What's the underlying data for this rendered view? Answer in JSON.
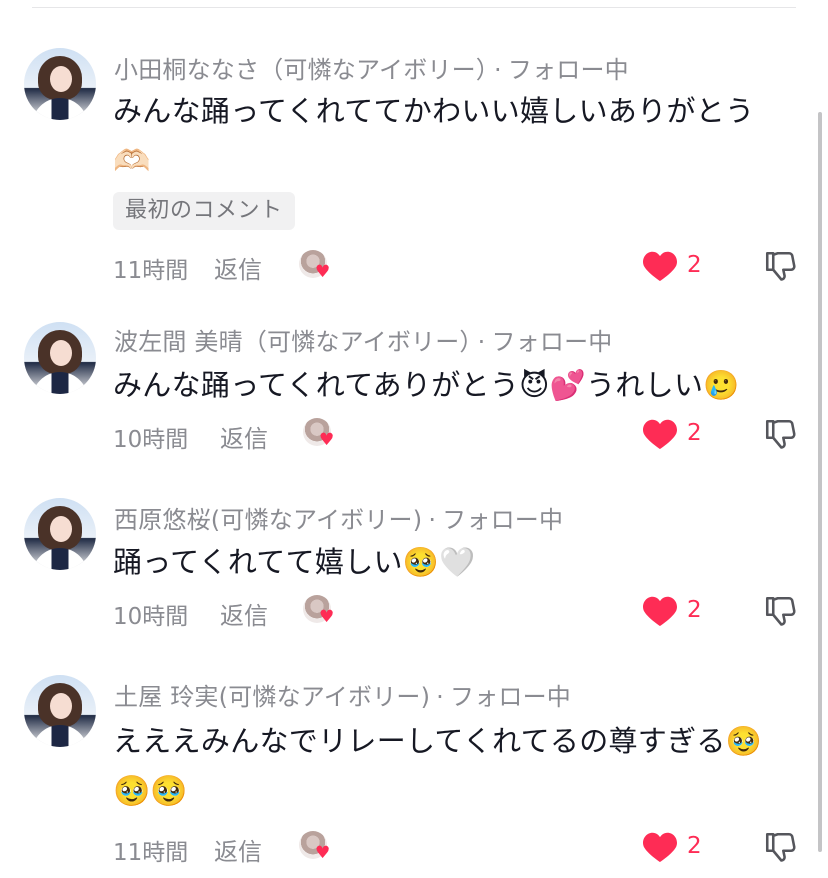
{
  "comments": [
    {
      "name": "小田桐ななさ（可憐なアイボリー）",
      "follow": "フォロー中",
      "text": "みんな踊ってくれててかわいい嬉しいありがとう",
      "emoji_line": "🫶🏻",
      "tag": "最初のコメント",
      "time": "11時間",
      "reply": "返信",
      "likes": "2"
    },
    {
      "name": "波左間 美晴（可憐なアイボリー）",
      "follow": "フォロー中",
      "text": "みんな踊ってくれてありがとう😈💕うれしい🥲",
      "time": "10時間",
      "reply": "返信",
      "likes": "2"
    },
    {
      "name": "西原悠桜(可憐なアイボリー)",
      "follow": "フォロー中",
      "text": "踊ってくれてて嬉しい🥹🤍",
      "time": "10時間",
      "reply": "返信",
      "likes": "2"
    },
    {
      "name": "土屋 玲実(可憐なアイボリー)",
      "follow": "フォロー中",
      "text": "えええみんなでリレーしてくれてるの尊すぎる🥹",
      "emoji_line": "🥹🥹",
      "time": "11時間",
      "reply": "返信",
      "likes": "2"
    }
  ],
  "separator": "·",
  "colors": {
    "like": "#fe2c55",
    "secondary_text": "#8a8b91",
    "primary_text": "#161823"
  },
  "icons": {
    "like": "heart-icon",
    "dislike": "thumbs-down-icon",
    "creator_liked": "creator-liked-avatar"
  }
}
